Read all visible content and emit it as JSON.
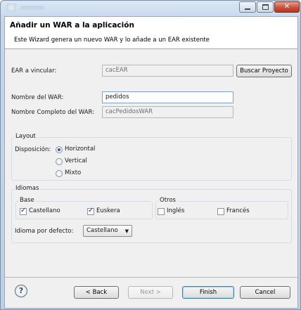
{
  "window": {
    "controls": {
      "minimize_icon": "minimize-icon",
      "maximize_icon": "maximize-icon",
      "close_icon": "close-icon",
      "close_glyph": "✕"
    }
  },
  "banner": {
    "title": "Añadir un WAR a la aplicación",
    "description": "Este Wizard genera un nuevo WAR y lo añade a un EAR existente"
  },
  "ear": {
    "label": "EAR a vincular:",
    "value": "cacEAR",
    "browse_button": "Buscar Proyecto"
  },
  "war": {
    "name_label": "Nombre del WAR:",
    "name_value": "pedidos",
    "full_name_label": "Nombre Completo del WAR:",
    "full_name_value": "cacPedidosWAR"
  },
  "layout": {
    "group_title": "Layout",
    "disposition_label": "Disposición:",
    "options": [
      {
        "label": "Horizontal",
        "selected": true
      },
      {
        "label": "Vertical",
        "selected": false
      },
      {
        "label": "Mixto",
        "selected": false
      }
    ]
  },
  "idiomas": {
    "group_title": "Idiomas",
    "base": {
      "title": "Base",
      "items": [
        {
          "label": "Castellano",
          "checked": true
        },
        {
          "label": "Euskera",
          "checked": true
        }
      ]
    },
    "otros": {
      "title": "Otros",
      "items": [
        {
          "label": "Inglés",
          "checked": false
        },
        {
          "label": "Francés",
          "checked": false
        }
      ]
    },
    "default_label": "Idioma por defecto:",
    "default_value": "Castellano",
    "dropdown_arrow": "▼"
  },
  "footer": {
    "help_glyph": "?",
    "back": "< Back",
    "next": "Next >",
    "finish": "Finish",
    "cancel": "Cancel"
  }
}
